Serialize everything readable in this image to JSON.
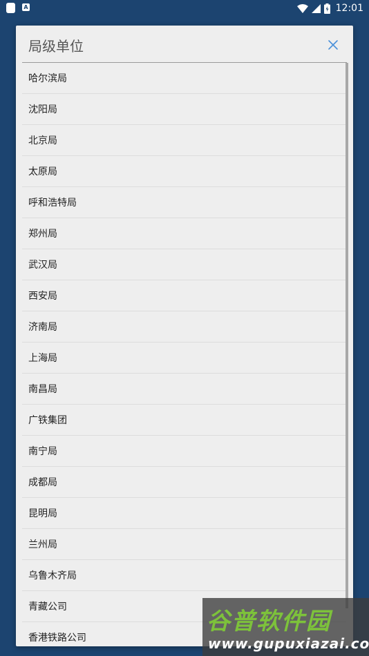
{
  "statusbar": {
    "time": "12:01",
    "notif_glyph": "A",
    "icons": [
      "app-square-icon",
      "notification-a-icon",
      "wifi-icon",
      "signal-icon",
      "battery-icon"
    ]
  },
  "dialog": {
    "title": "局级单位",
    "close_icon": "close-icon",
    "items": [
      "哈尔滨局",
      "沈阳局",
      "北京局",
      "太原局",
      "呼和浩特局",
      "郑州局",
      "武汉局",
      "西安局",
      "济南局",
      "上海局",
      "南昌局",
      "广铁集团",
      "南宁局",
      "成都局",
      "昆明局",
      "兰州局",
      "乌鲁木齐局",
      "青藏公司",
      "香港铁路公司"
    ]
  },
  "watermark": {
    "text": "谷普软件园",
    "url": "www.gupuxiazai.com"
  },
  "colors": {
    "background": "#1c4470",
    "dialog": "#eeeeee",
    "accent": "#4a90d9",
    "watermark_green": "#7dc23b"
  }
}
